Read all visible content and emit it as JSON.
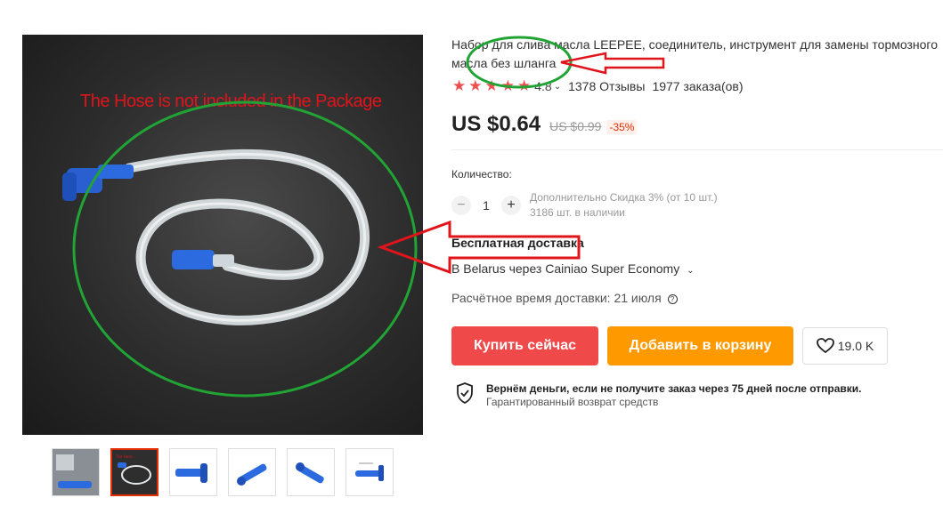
{
  "gallery": {
    "overlay_text": "The Hose is not included in the Package",
    "thumbnails": [
      "thumb-1",
      "thumb-2",
      "thumb-3",
      "thumb-4",
      "thumb-5",
      "thumb-6"
    ],
    "active_index": 1
  },
  "product": {
    "title": "Набор для слива масла LEEPEE, соединитель, инструмент для замены тормозного масла без шланга",
    "rating": "4.8",
    "stars": 5,
    "reviews": "1378 Отзывы",
    "orders": "1977 заказа(ов)",
    "price": "US $0.64",
    "old_price": "US $0.99",
    "discount": "-35%"
  },
  "quantity": {
    "label": "Количество:",
    "value": "1",
    "minus": "−",
    "plus": "+",
    "discount_info": "Дополнительно Скидка 3% (от 10 шт.)",
    "stock": "3186 шт. в наличии"
  },
  "shipping": {
    "title": "Бесплатная доставка",
    "method": "В Belarus через Cainiao Super Economy",
    "delivery_time": "Расчётное время доставки: 21 июля"
  },
  "actions": {
    "buy_now": "Купить сейчас",
    "add_to_cart": "Добавить в корзину",
    "wishlist_count": "19.0 K"
  },
  "guarantee": {
    "main": "Вернём деньги, если не получите заказ через 75 дней после отправки.",
    "sub": "Гарантированный возврат средств"
  },
  "colors": {
    "buy": "#f0494a",
    "cart": "#ff9900",
    "annotation_red": "#e0141b",
    "annotation_green": "#22a335",
    "star": "#ef4f4f"
  }
}
